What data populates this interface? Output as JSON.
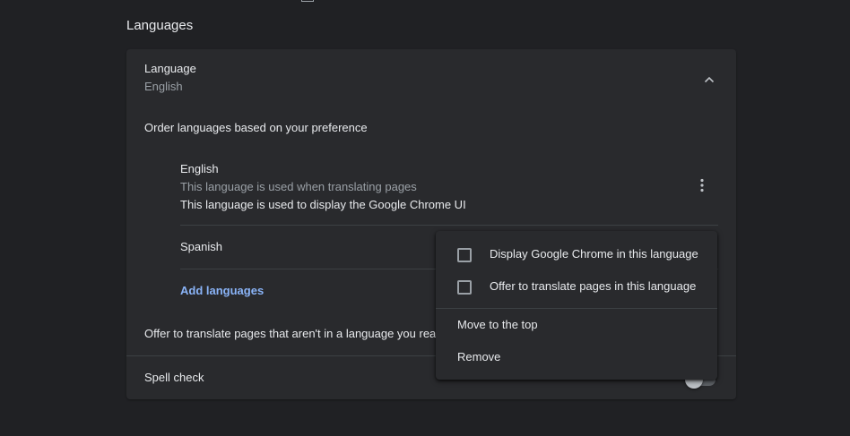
{
  "section": {
    "title": "Languages"
  },
  "language": {
    "label": "Language",
    "value": "English",
    "expand_icon": "chevron-up-icon",
    "order_text": "Order languages based on your preference",
    "entries": [
      {
        "name": "English",
        "note_translate": "This language is used when translating pages",
        "note_ui": "This language is used to display the Google Chrome UI",
        "more_icon": "more-vert-icon"
      },
      {
        "name": "Spanish"
      }
    ],
    "add_languages": "Add languages",
    "offer_translate": "Offer to translate pages that aren't in a language you read"
  },
  "spell_check": {
    "label": "Spell check",
    "enabled": false
  },
  "context_menu": {
    "display_ui": "Display Google Chrome in this language",
    "display_ui_checked": false,
    "offer_translate": "Offer to translate pages in this language",
    "offer_translate_checked": false,
    "move_top": "Move to the top",
    "remove": "Remove"
  },
  "colors": {
    "background": "#202124",
    "card": "#292a2d",
    "text_primary": "#e8eaed",
    "text_secondary": "#9aa0a6",
    "link": "#8ab4f8",
    "divider": "#3c4043"
  }
}
